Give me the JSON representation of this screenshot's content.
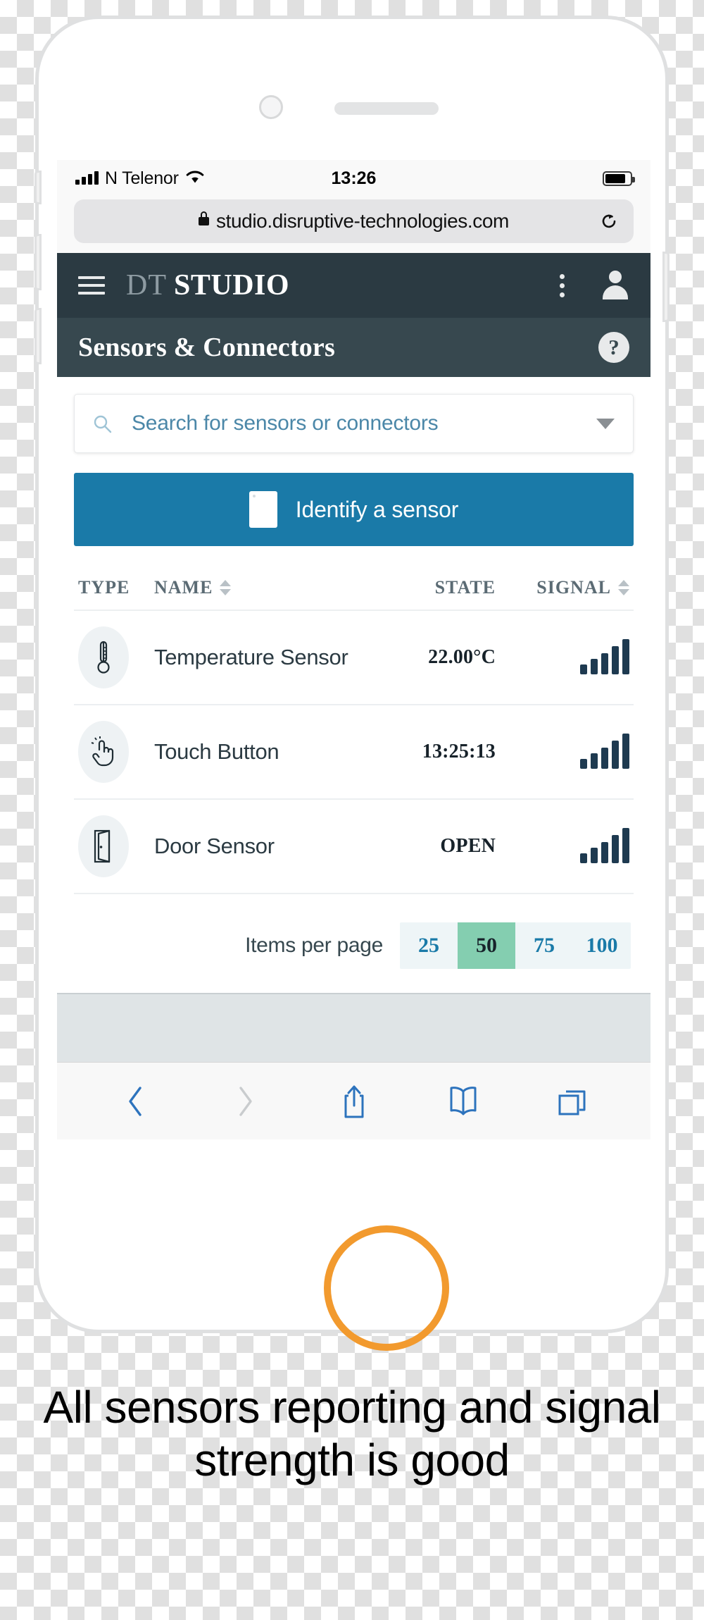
{
  "statusbar": {
    "carrier": "N Telenor",
    "time": "13:26",
    "signal_icon": "cellular-signal-icon",
    "wifi_icon": "wifi-icon",
    "battery_icon": "battery-icon"
  },
  "browser": {
    "url": "studio.disruptive-technologies.com",
    "lock_icon": "lock-icon",
    "reload_icon": "reload-icon",
    "toolbar": {
      "back": "back-icon",
      "forward": "forward-icon",
      "share": "share-icon",
      "bookmarks": "bookmarks-icon",
      "tabs": "tabs-icon"
    }
  },
  "app": {
    "menu_icon": "hamburger-menu-icon",
    "brand_prefix": "DT",
    "brand_name": "STUDIO",
    "overflow_icon": "kebab-menu-icon",
    "account_icon": "account-avatar-icon",
    "page_title": "Sensors & Connectors",
    "help_label": "?"
  },
  "search": {
    "placeholder": "Search for sensors or connectors",
    "icon": "search-icon",
    "dropdown_icon": "chevron-down-icon"
  },
  "identify": {
    "label": "Identify a sensor",
    "icon": "sensor-chip-icon"
  },
  "table": {
    "headers": {
      "type": "TYPE",
      "name": "NAME",
      "state": "STATE",
      "signal": "SIGNAL"
    },
    "rows": [
      {
        "icon": "thermometer-icon",
        "name": "Temperature Sensor",
        "state": "22.00°C",
        "signal_bars": 5
      },
      {
        "icon": "touch-button-icon",
        "name": "Touch Button",
        "state": "13:25:13",
        "signal_bars": 5
      },
      {
        "icon": "door-icon",
        "name": "Door Sensor",
        "state": "OPEN",
        "signal_bars": 5
      }
    ]
  },
  "pagination": {
    "label": "Items per page",
    "options": [
      "25",
      "50",
      "75",
      "100"
    ],
    "selected": "50"
  },
  "caption": "All sensors reporting and signal strength is good",
  "colors": {
    "header_bg": "#2b3a42",
    "titlebar_bg": "#37484f",
    "primary_button": "#1a7aa8",
    "accent_link": "#1a7aa8",
    "selected_page": "#84ceb0",
    "signal_bar": "#1e3a50",
    "home_button_ring": "#f29a2e"
  }
}
